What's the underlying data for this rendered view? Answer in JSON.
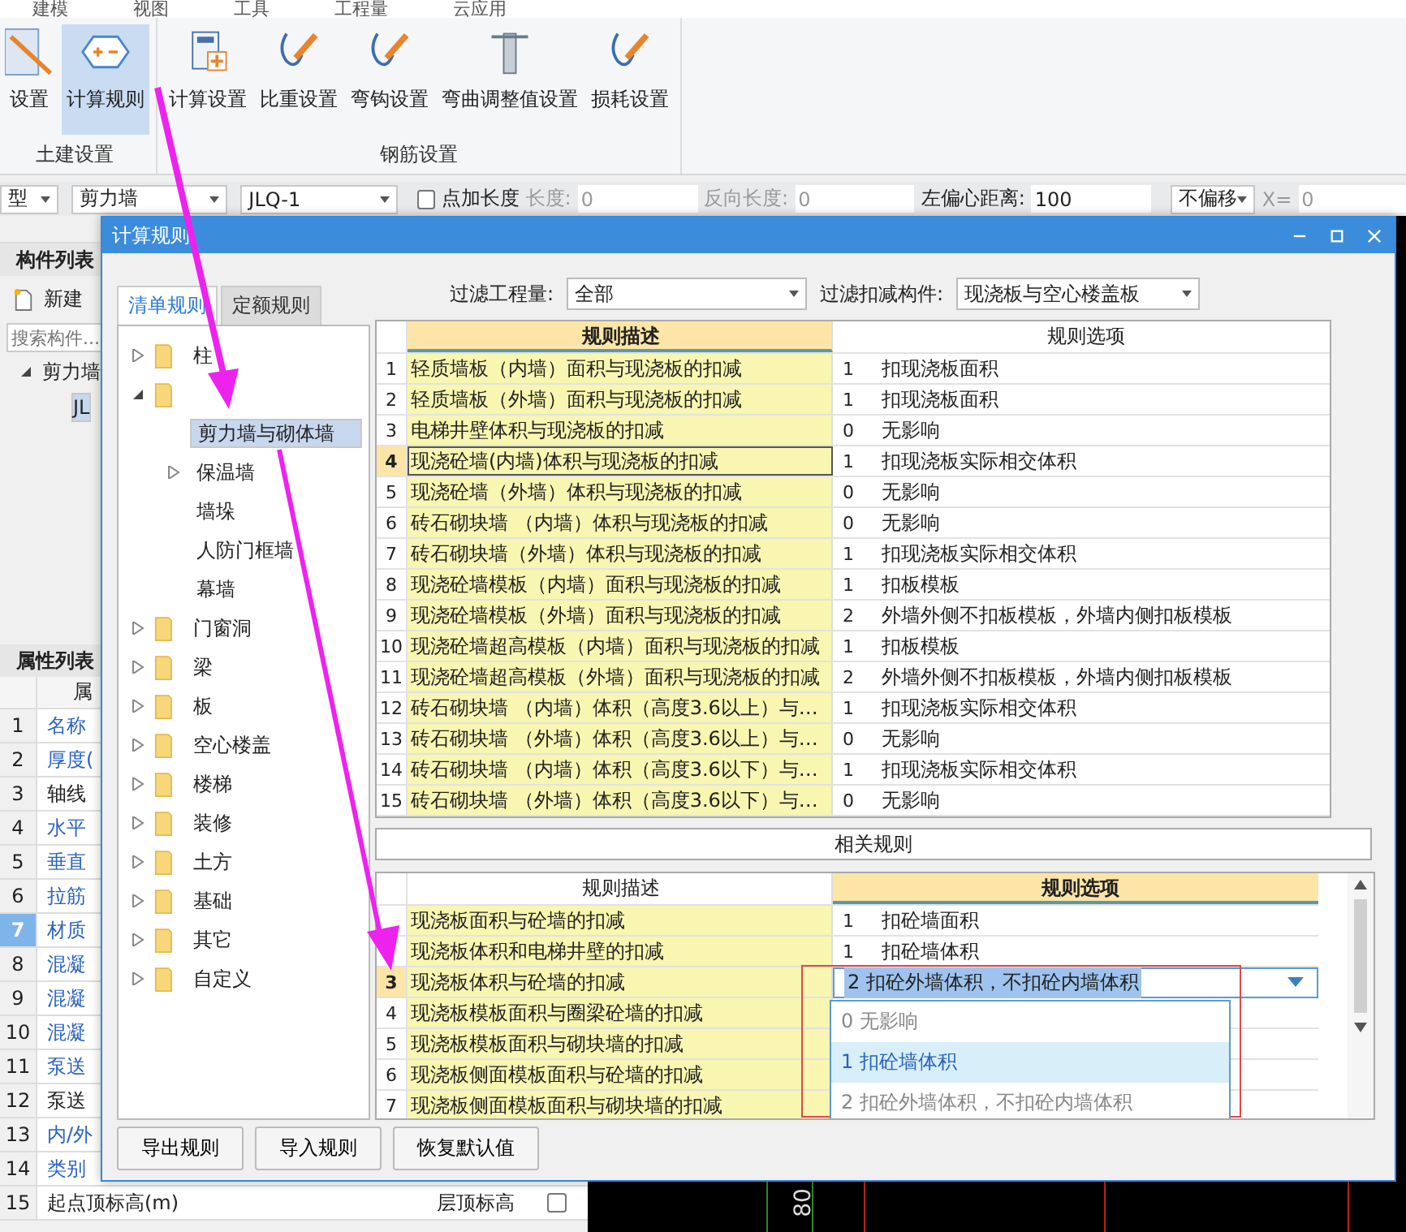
{
  "menu": [
    {
      "label": "建模"
    },
    {
      "label": "视图"
    },
    {
      "label": "工具"
    },
    {
      "label": "工程量"
    },
    {
      "label": "云应用"
    }
  ],
  "ribbon": {
    "groups": [
      {
        "title": "土建设置",
        "buttons": [
          {
            "label": "设置",
            "selected": false
          },
          {
            "label": "计算规则",
            "selected": true
          }
        ]
      },
      {
        "title": "钢筋设置",
        "buttons": [
          {
            "label": "计算设置",
            "selected": false
          },
          {
            "label": "比重设置",
            "selected": false
          },
          {
            "label": "弯钩设置",
            "selected": false
          },
          {
            "label": "弯曲调整值设置",
            "selected": false
          },
          {
            "label": "损耗设置",
            "selected": false
          }
        ]
      }
    ]
  },
  "toolbar": {
    "type_dropdown": "型",
    "component_dropdown": "剪力墙",
    "name_dropdown": "JLQ-1",
    "add_length": {
      "label": "点加长度",
      "checked": false
    },
    "fields": [
      {
        "label": "长度:",
        "value": "0",
        "disabled": true
      },
      {
        "label": "反向长度:",
        "value": "0",
        "disabled": true
      },
      {
        "label": "左偏心距离:",
        "value": "100",
        "disabled": false
      }
    ],
    "offset_dropdown": "不偏移",
    "x_field": {
      "label": "X=",
      "value": "0",
      "disabled": true
    }
  },
  "component_list": {
    "title": "构件列表",
    "new_button": "新建",
    "search": {
      "placeholder": "搜索构件..."
    },
    "tree": [
      {
        "label": "剪力墙",
        "expanded": true,
        "selected": false,
        "children": [
          {
            "label": "JL",
            "selected": true
          }
        ]
      }
    ]
  },
  "properties": {
    "title": "属性列表",
    "column": "属",
    "rows": [
      {
        "num": "1",
        "name": "名称",
        "link": true,
        "selected": false
      },
      {
        "num": "2",
        "name": "厚度(",
        "link": true,
        "selected": false
      },
      {
        "num": "3",
        "name": "轴线",
        "link": false,
        "selected": false
      },
      {
        "num": "4",
        "name": "水平",
        "link": true,
        "selected": false
      },
      {
        "num": "5",
        "name": "垂直",
        "link": true,
        "selected": false
      },
      {
        "num": "6",
        "name": "拉筋",
        "link": true,
        "selected": false
      },
      {
        "num": "7",
        "name": "材质",
        "link": true,
        "selected": true
      },
      {
        "num": "8",
        "name": "混凝",
        "link": true,
        "selected": false
      },
      {
        "num": "9",
        "name": "混凝",
        "link": true,
        "selected": false
      },
      {
        "num": "10",
        "name": "混凝",
        "link": true,
        "selected": false
      },
      {
        "num": "11",
        "name": "泵送",
        "link": true,
        "selected": false
      },
      {
        "num": "12",
        "name": "泵送",
        "link": false,
        "selected": false
      },
      {
        "num": "13",
        "name": "内/外",
        "link": true,
        "selected": false
      },
      {
        "num": "14",
        "name": "类别",
        "link": true,
        "selected": false
      },
      {
        "num": "15",
        "name": "起点顶标高(m)",
        "link": false,
        "selected": false,
        "value": "层顶标高",
        "checked": false
      }
    ]
  },
  "canvas": {
    "label": "80"
  },
  "dialog": {
    "title": "计算规则",
    "tabs": [
      {
        "label": "清单规则",
        "selected": true
      },
      {
        "label": "定额规则",
        "selected": false
      }
    ],
    "tree": [
      {
        "label": "柱",
        "expanded": false,
        "selected": false
      },
      {
        "expanded": true,
        "children": [
          {
            "label": "剪力墙与砌体墙",
            "selected": true
          },
          {
            "label": "保温墙",
            "expanded": false,
            "selected": false
          },
          {
            "label": "墙垛",
            "selected": false
          },
          {
            "label": "人防门框墙",
            "selected": false
          },
          {
            "label": "幕墙",
            "selected": false
          }
        ]
      },
      {
        "label": "门窗洞",
        "expanded": false,
        "selected": false
      },
      {
        "label": "梁",
        "expanded": false,
        "selected": false
      },
      {
        "label": "板",
        "expanded": false,
        "selected": false
      },
      {
        "label": "空心楼盖",
        "expanded": false,
        "selected": false
      },
      {
        "label": "楼梯",
        "expanded": false,
        "selected": false
      },
      {
        "label": "装修",
        "expanded": false,
        "selected": false
      },
      {
        "label": "土方",
        "expanded": false,
        "selected": false
      },
      {
        "label": "基础",
        "expanded": false,
        "selected": false
      },
      {
        "label": "其它",
        "expanded": false,
        "selected": false
      },
      {
        "label": "自定义",
        "expanded": false,
        "selected": false
      }
    ],
    "filters": [
      {
        "label": "过滤工程量:",
        "value": "全部"
      },
      {
        "label": "过滤扣减构件:",
        "value": "现浇板与空心楼盖板"
      }
    ],
    "rules_table": {
      "columns": [
        "规则描述",
        "规则选项"
      ],
      "rows": [
        {
          "num": "1",
          "desc": "轻质墙板（内墙）面积与现浇板的扣减",
          "code": "1",
          "option": "扣现浇板面积",
          "selected": false
        },
        {
          "num": "2",
          "desc": "轻质墙板（外墙）面积与现浇板的扣减",
          "code": "1",
          "option": "扣现浇板面积",
          "selected": false
        },
        {
          "num": "3",
          "desc": "电梯井壁体积与现浇板的扣减",
          "code": "0",
          "option": "无影响",
          "selected": false
        },
        {
          "num": "4",
          "desc": "现浇砼墙(内墙)体积与现浇板的扣减",
          "code": "1",
          "option": "扣现浇板实际相交体积",
          "selected": true
        },
        {
          "num": "5",
          "desc": "现浇砼墙（外墙）体积与现浇板的扣减",
          "code": "0",
          "option": "无影响",
          "selected": false
        },
        {
          "num": "6",
          "desc": "砖石砌块墙 （内墙）体积与现浇板的扣减",
          "code": "0",
          "option": "无影响",
          "selected": false
        },
        {
          "num": "7",
          "desc": "砖石砌块墙（外墙）体积与现浇板的扣减",
          "code": "1",
          "option": "扣现浇板实际相交体积",
          "selected": false
        },
        {
          "num": "8",
          "desc": "现浇砼墙模板（内墙）面积与现浇板的扣减",
          "code": "1",
          "option": "扣板模板",
          "selected": false
        },
        {
          "num": "9",
          "desc": "现浇砼墙模板（外墙）面积与现浇板的扣减",
          "code": "2",
          "option": "外墙外侧不扣板模板，外墙内侧扣板模板",
          "selected": false
        },
        {
          "num": "10",
          "desc": "现浇砼墙超高模板（内墙）面积与现浇板的扣减",
          "code": "1",
          "option": "扣板模板",
          "selected": false
        },
        {
          "num": "11",
          "desc": "现浇砼墙超高模板（外墙）面积与现浇板的扣减",
          "code": "2",
          "option": "外墙外侧不扣板模板，外墙内侧扣板模板",
          "selected": false
        },
        {
          "num": "12",
          "desc": "砖石砌块墙 （内墙）体积（高度3.6以上）与…",
          "code": "1",
          "option": "扣现浇板实际相交体积",
          "selected": false
        },
        {
          "num": "13",
          "desc": "砖石砌块墙 （外墙）体积（高度3.6以上）与…",
          "code": "0",
          "option": "无影响",
          "selected": false
        },
        {
          "num": "14",
          "desc": "砖石砌块墙 （内墙）体积（高度3.6以下）与…",
          "code": "1",
          "option": "扣现浇板实际相交体积",
          "selected": false
        },
        {
          "num": "15",
          "desc": "砖石砌块墙 （外墙）体积（高度3.6以下）与…",
          "code": "0",
          "option": "无影响",
          "selected": false
        }
      ]
    },
    "related": {
      "title": "相关规则",
      "columns": [
        "规则描述",
        "规则选项"
      ],
      "rows": [
        {
          "desc": "现浇板面积与砼墙的扣减",
          "kind": "text",
          "code": "1",
          "option": "扣砼墙面积",
          "selected": false
        },
        {
          "desc": "现浇板体积和电梯井壁的扣减",
          "kind": "text",
          "code": "1",
          "option": "扣砼墙体积",
          "selected": false
        },
        {
          "num": "3",
          "desc": "现浇板体积与砼墙的扣减",
          "kind": "dropdown",
          "code": "2",
          "option": "扣砼外墙体积，不扣砼内墙体积",
          "selected": true
        },
        {
          "num": "4",
          "desc": "现浇板模板面积与圈梁砼墙的扣减",
          "kind": "hidden",
          "selected": false
        },
        {
          "num": "5",
          "desc": "现浇板模板面积与砌块墙的扣减",
          "kind": "hidden",
          "selected": false
        },
        {
          "num": "6",
          "desc": "现浇板侧面模板面积与砼墙的扣减",
          "kind": "hidden",
          "selected": false
        },
        {
          "num": "7",
          "desc": "现浇板侧面模板面积与砌块墙的扣减",
          "kind": "hidden",
          "selected": false
        }
      ],
      "options": [
        {
          "code": "0",
          "label": "无影响",
          "selected": false
        },
        {
          "code": "1",
          "label": "扣砼墙体积",
          "selected": true
        },
        {
          "code": "2",
          "label": "扣砼外墙体积，不扣砼内墙体积",
          "selected": false
        }
      ]
    },
    "buttons": [
      {
        "label": "导出规则"
      },
      {
        "label": "导入规则"
      },
      {
        "label": "恢复默认值"
      }
    ]
  }
}
